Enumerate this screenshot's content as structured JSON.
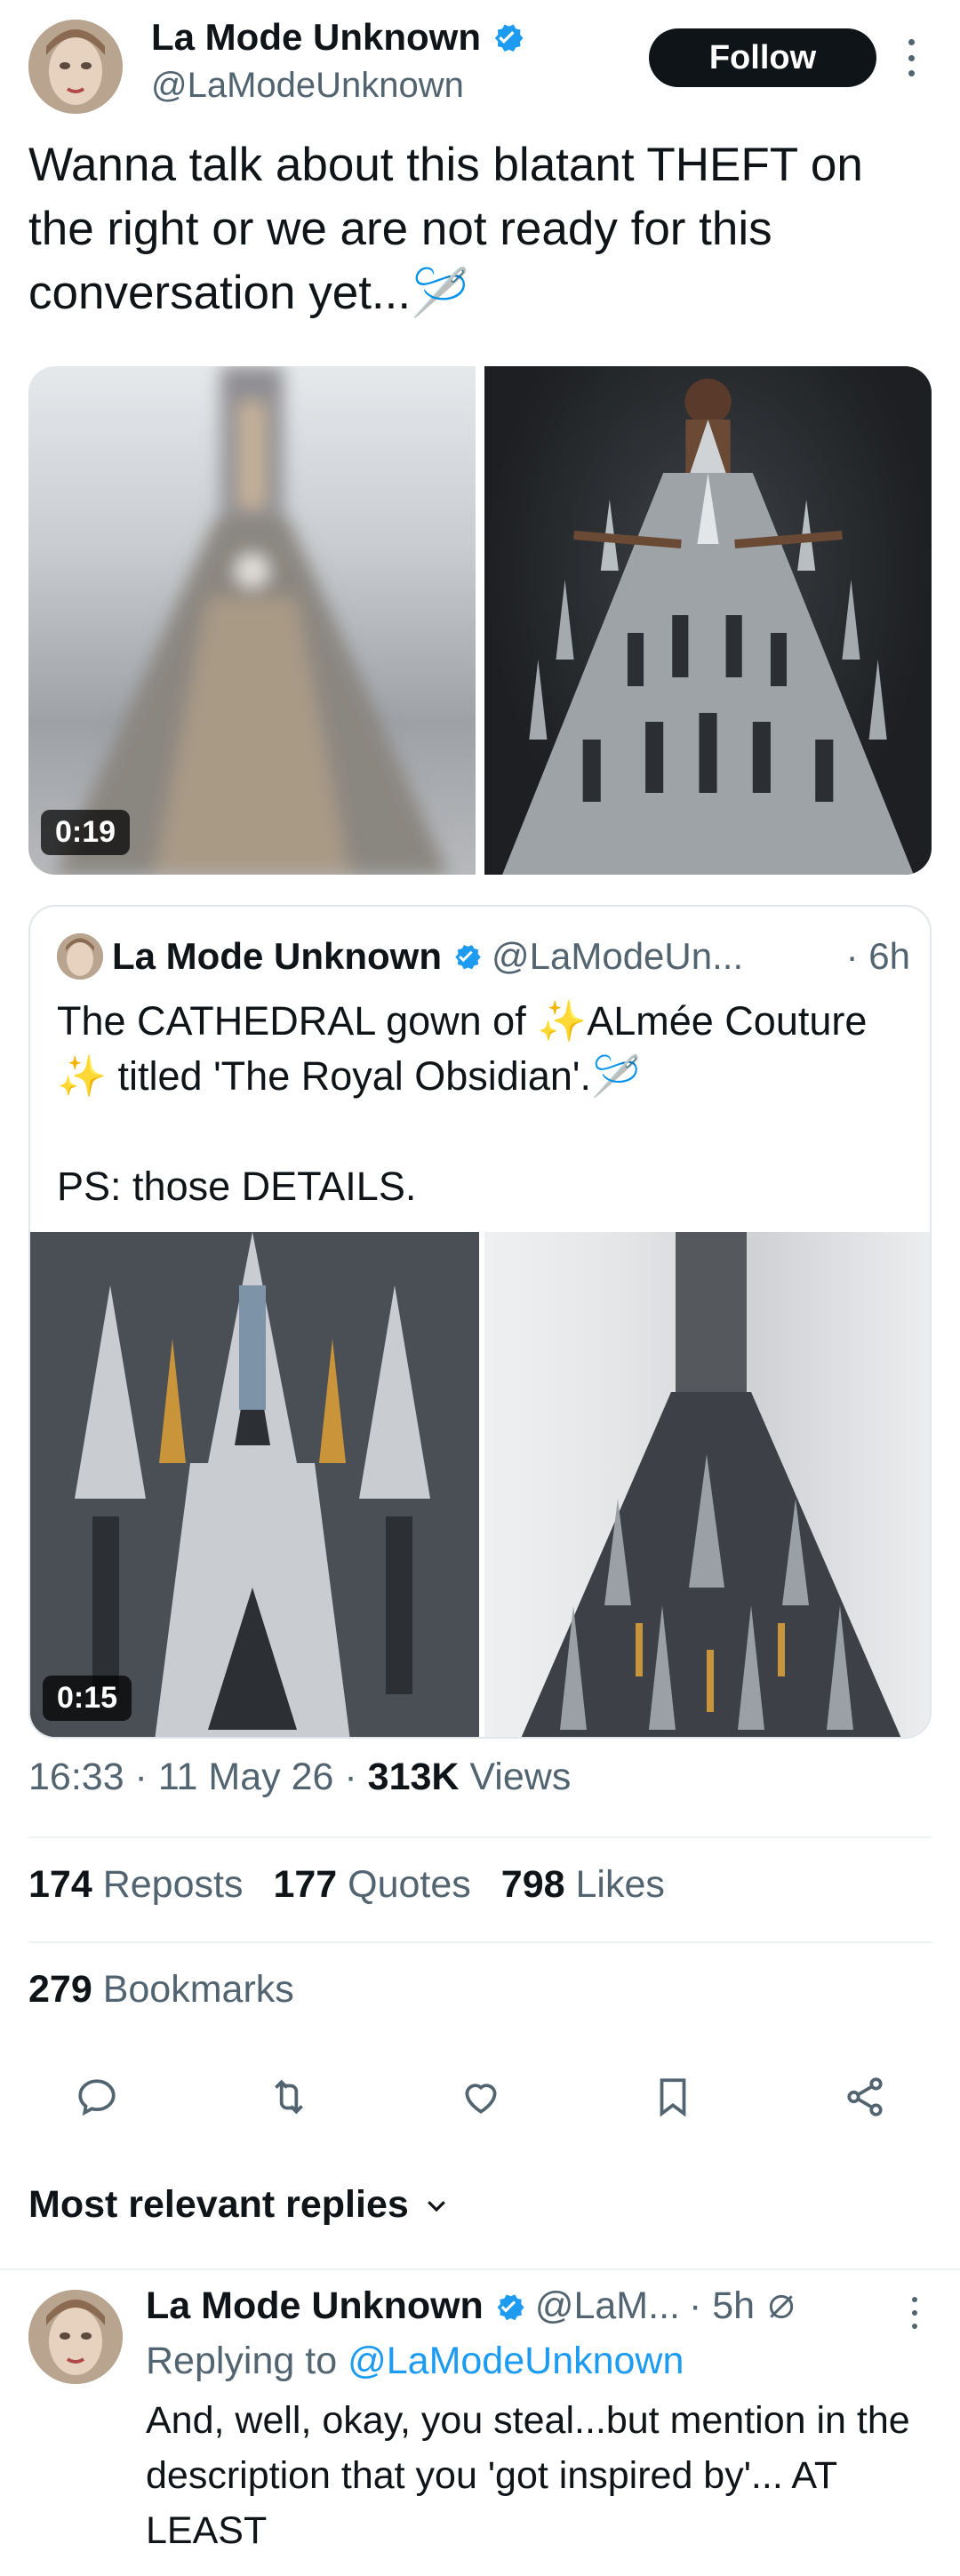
{
  "post": {
    "author_name": "La Mode Unknown",
    "author_handle": "@LaModeUnknown",
    "follow_label": "Follow",
    "text": "Wanna talk about this blatant THEFT on the right or we are not ready for this conversation yet...🪡",
    "media": [
      {
        "type": "video",
        "duration": "0:19",
        "description": "blurred dress photo"
      },
      {
        "type": "image",
        "description": "cathedral-shaped gown on model"
      }
    ]
  },
  "quoted_post": {
    "author_name": "La Mode Unknown",
    "author_handle": "@LaModeUn...",
    "time": "· 6h",
    "text": "The CATHEDRAL gown of ✨ALmée Couture ✨ titled 'The Royal Obsidian'.🪡\n\nPS: those DETAILS.",
    "media": [
      {
        "type": "video",
        "duration": "0:15",
        "description": "gown detail close-up"
      },
      {
        "type": "image",
        "description": "full cathedral gown on mannequin"
      }
    ]
  },
  "meta": {
    "time": "16:33",
    "date": "11 May 26",
    "views_count": "313K",
    "views_label": "Views"
  },
  "stats": {
    "reposts_count": "174",
    "reposts_label": "Reposts",
    "quotes_count": "177",
    "quotes_label": "Quotes",
    "likes_count": "798",
    "likes_label": "Likes",
    "bookmarks_count": "279",
    "bookmarks_label": "Bookmarks"
  },
  "actions": [
    "reply-icon",
    "repost-icon",
    "like-icon",
    "bookmark-icon",
    "share-icon"
  ],
  "replies_sort": {
    "label": "Most relevant replies"
  },
  "reply": {
    "author_name": "La Mode Unknown",
    "author_handle": "@LaM...",
    "time": "· 5h",
    "replying_prefix": "Replying to",
    "replying_handle": "@LaModeUnknown",
    "text": "And, well, okay, you steal...but mention in the description that you 'got inspired by'... AT LEAST"
  },
  "colors": {
    "text": "#0f1419",
    "muted": "#536471",
    "accent": "#1d9bf0",
    "verified": "#1d9bf0",
    "follow_bg": "#0f1419"
  }
}
